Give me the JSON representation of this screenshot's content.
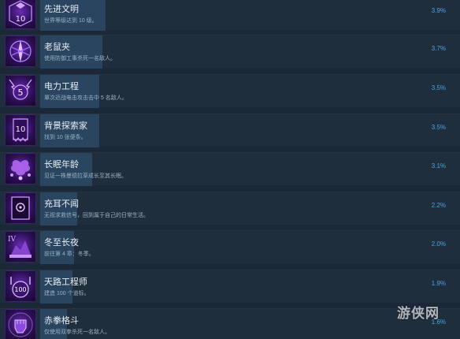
{
  "colors": {
    "background": "#1b2838",
    "row_background": "#1f2e3c",
    "progress_fill": "#2a4560",
    "percent_text": "#4aa3df",
    "icon_purple": "#6a2bb8"
  },
  "achievements": [
    {
      "title": "先进文明",
      "desc": "世界等级达到 10 级。",
      "percent": "3.9%",
      "progress": 0.039,
      "icon": "level-10-icon",
      "icon_text": "10"
    },
    {
      "title": "老鼠夹",
      "desc": "使用防御工事杀死一名敌人。",
      "percent": "3.7%",
      "progress": 0.037,
      "icon": "trap-icon",
      "icon_text": ""
    },
    {
      "title": "电力工程",
      "desc": "單次近战电击攻击击中 5 名敌人。",
      "percent": "3.5%",
      "progress": 0.035,
      "icon": "lightning-5-icon",
      "icon_text": "5"
    },
    {
      "title": "背景探索家",
      "desc": "找到 10 张便条。",
      "percent": "3.5%",
      "progress": 0.035,
      "icon": "notes-10-icon",
      "icon_text": "10"
    },
    {
      "title": "长眠年龄",
      "desc": "见证一株曼德拉草成长至其长眠。",
      "percent": "3.1%",
      "progress": 0.031,
      "icon": "mandrake-icon",
      "icon_text": ""
    },
    {
      "title": "充耳不闻",
      "desc": "无视求救信号，回到属于自己的日常生活。",
      "percent": "2.2%",
      "progress": 0.022,
      "icon": "signal-doorway-icon",
      "icon_text": ""
    },
    {
      "title": "冬至长夜",
      "desc": "前往第 4 章：冬季。",
      "percent": "2.0%",
      "progress": 0.02,
      "icon": "chapter-4-icon",
      "icon_text": "IV"
    },
    {
      "title": "天路工程师",
      "desc": "建造 100 个道标。",
      "percent": "1.9%",
      "progress": 0.019,
      "icon": "skyroad-100-icon",
      "icon_text": "100"
    },
    {
      "title": "赤拳格斗",
      "desc": "仅使用双拳杀死一名敌人。",
      "percent": "1.6%",
      "progress": 0.016,
      "icon": "fist-icon",
      "icon_text": ""
    }
  ],
  "watermark": {
    "text": "游侠网"
  }
}
